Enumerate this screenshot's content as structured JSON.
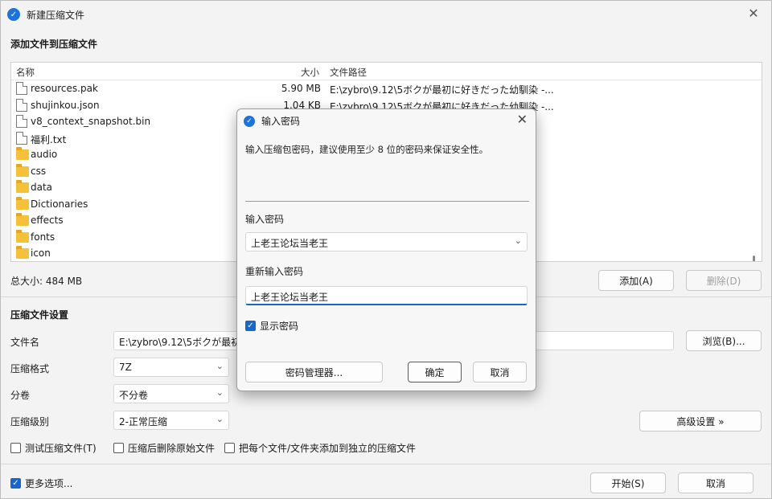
{
  "window": {
    "title": "新建压缩文件",
    "add_section": "添加文件到压缩文件",
    "columns": {
      "name": "名称",
      "size": "大小",
      "path": "文件路径"
    },
    "files": [
      {
        "name": "resources.pak",
        "size": "5.90 MB",
        "path": "E:\\zybro\\9.12\\5ボクが最初に好きだった幼馴染 -...",
        "type": "file"
      },
      {
        "name": "shujinkou.json",
        "size": "1.04 KB",
        "path": "E:\\zybro\\9.12\\5ボクが最初に好きだった幼馴染 -...",
        "type": "file"
      },
      {
        "name": "v8_context_snapshot.bin",
        "size": "",
        "path": "",
        "type": "file"
      },
      {
        "name": "福利.txt",
        "size": "",
        "path": "",
        "type": "file"
      },
      {
        "name": "audio",
        "size": "",
        "path": "",
        "type": "folder"
      },
      {
        "name": "css",
        "size": "",
        "path": "",
        "type": "folder"
      },
      {
        "name": "data",
        "size": "",
        "path": "",
        "type": "folder"
      },
      {
        "name": "Dictionaries",
        "size": "",
        "path": "",
        "type": "folder"
      },
      {
        "name": "effects",
        "size": "",
        "path": "",
        "type": "folder"
      },
      {
        "name": "fonts",
        "size": "",
        "path": "",
        "type": "folder"
      },
      {
        "name": "icon",
        "size": "",
        "path": "",
        "type": "folder"
      }
    ],
    "total_size": "总大小: 484 MB",
    "add_button": "添加(A)",
    "delete_button": "删除(D)",
    "settings_section": "压缩文件设置",
    "filename_label": "文件名",
    "filename_value": "E:\\zybro\\9.12\\5ボクが最初に",
    "browse_button": "浏览(B)...",
    "format_label": "压缩格式",
    "format_value": "7Z",
    "split_label": "分卷",
    "split_value": "不分卷",
    "level_label": "压缩级别",
    "level_value": "2-正常压缩",
    "advanced_button": "高级设置 »",
    "opt_test": "测试压缩文件(T)",
    "opt_delete": "压缩后删除原始文件",
    "opt_each": "把每个文件/文件夹添加到独立的压缩文件",
    "more_options": "更多选项...",
    "start_button": "开始(S)",
    "cancel_button": "取消"
  },
  "dialog": {
    "title": "输入密码",
    "description": "输入压缩包密码，建议使用至少 8 位的密码来保证安全性。",
    "password_label": "输入密码",
    "password_value": "上老王论坛当老王",
    "reenter_label": "重新输入密码",
    "reenter_value": "上老王论坛当老王",
    "show_password": "显示密码",
    "manager_button": "密码管理器...",
    "ok_button": "确定",
    "cancel_button": "取消"
  },
  "colors": {
    "accent": "#1a65c8",
    "folder": "#f5c13b"
  },
  "icons": {
    "app": "7z-app-icon",
    "close": "close-icon",
    "chevron": "chevron-down-icon"
  }
}
